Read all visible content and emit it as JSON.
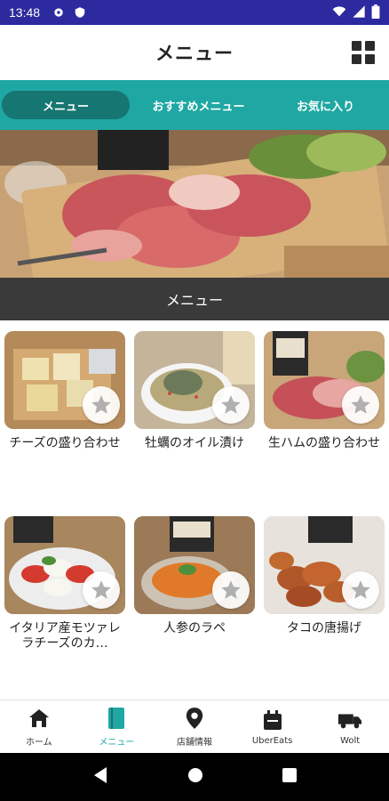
{
  "status_bar": {
    "time": "13:48"
  },
  "header": {
    "title": "メニュー"
  },
  "tabs": [
    {
      "label": "メニュー",
      "active": true
    },
    {
      "label": "おすすめメニュー",
      "active": false
    },
    {
      "label": "お気に入り",
      "active": false
    }
  ],
  "section": {
    "title": "メニュー"
  },
  "menu_items": [
    {
      "name": "チーズの盛り合わせ",
      "icon": "star-icon"
    },
    {
      "name": "牡蠣のオイル漬け",
      "icon": "star-icon"
    },
    {
      "name": "生ハムの盛り合わせ",
      "icon": "star-icon"
    },
    {
      "name": "イタリア産モツァレラチーズのカ…",
      "icon": "star-icon"
    },
    {
      "name": "人参のラペ",
      "icon": "star-icon"
    },
    {
      "name": "タコの唐揚げ",
      "icon": "star-icon"
    }
  ],
  "bottom_nav": [
    {
      "label": "ホーム",
      "icon": "home-icon"
    },
    {
      "label": "メニュー",
      "icon": "book-icon",
      "active": true
    },
    {
      "label": "店舗情報",
      "icon": "location-pin-icon"
    },
    {
      "label": "UberEats",
      "icon": "delivery-bag-icon"
    },
    {
      "label": "Wolt",
      "icon": "delivery-truck-icon"
    }
  ],
  "colors": {
    "accent": "#1fa7a3",
    "accent_dark": "#167672",
    "status_bar": "#2c2a9e",
    "section_bar": "#3a3a3a"
  }
}
